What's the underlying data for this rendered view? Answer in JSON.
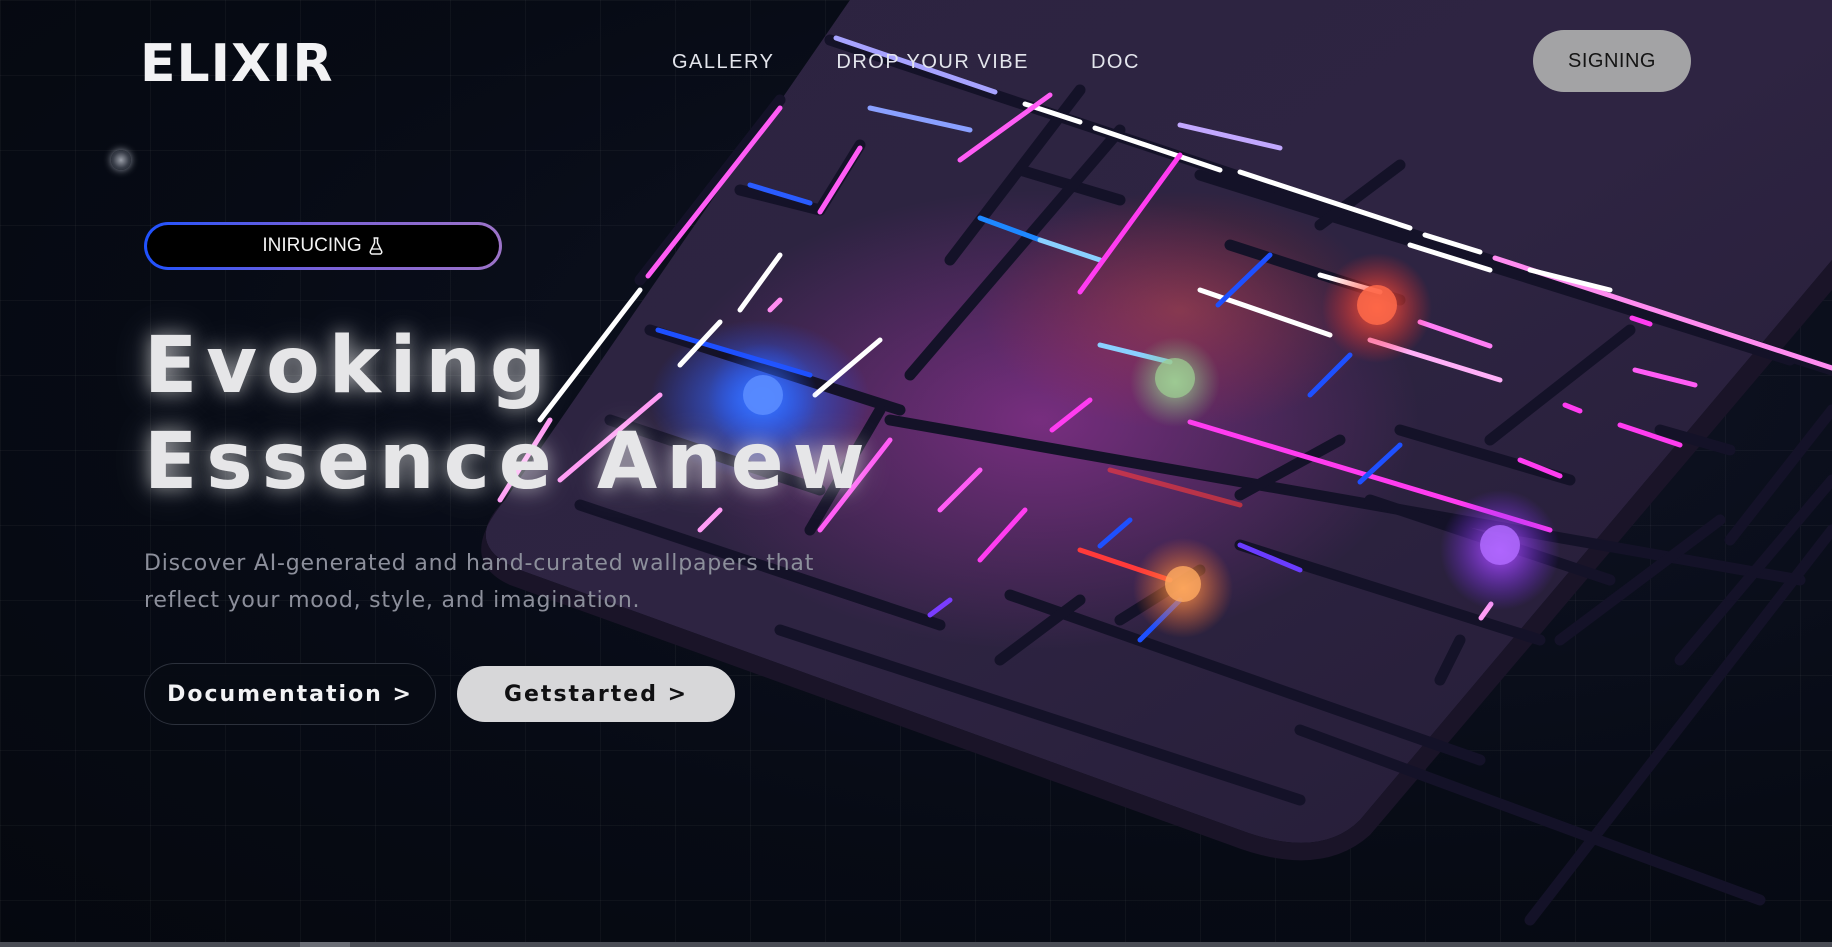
{
  "brand": {
    "logo": "ELIXIR"
  },
  "nav": {
    "items": [
      "GALLERY",
      "DROP YOUR VIBE",
      "DOC"
    ]
  },
  "header": {
    "signin_label": "SIGNING"
  },
  "hero": {
    "badge_text": "INIRUCING",
    "title_line1": "Evoking",
    "title_line2": "Essence Anew",
    "subtitle_line1": "Discover AI-generated and hand-curated wallpapers that",
    "subtitle_line2": "reflect your mood, style, and imagination.",
    "primary_button": "Documentation >",
    "secondary_button": "Getstarted >"
  },
  "colors": {
    "background": "#060a14",
    "board": "#2a2140",
    "glow_blue": "#1e64ff",
    "glow_pink": "#ff3cf0",
    "glow_red": "#ff3a2a",
    "glow_violet": "#a03cff",
    "glow_orange": "#ff8a3a",
    "glow_green": "#8fd48a"
  },
  "icons": {
    "badge_icon": "flask-icon",
    "indicator": "dot-icon"
  }
}
